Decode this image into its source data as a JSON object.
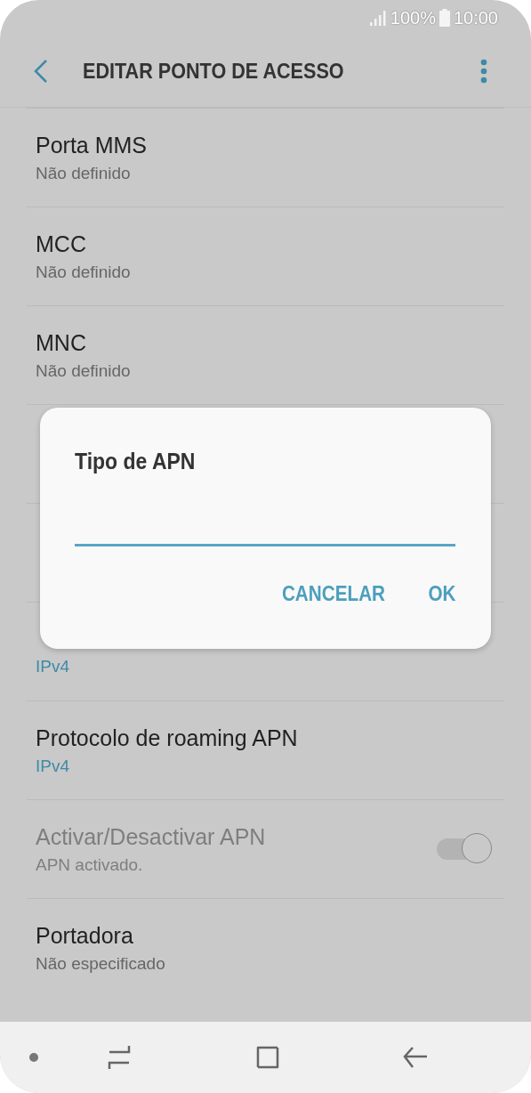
{
  "status_bar": {
    "battery": "100%",
    "time": "10:00"
  },
  "header": {
    "title": "EDITAR PONTO DE ACESSO"
  },
  "settings": [
    {
      "kind": "text",
      "title": "Porta MMS",
      "value": "Não definido",
      "highlighted": false,
      "disabled": false
    },
    {
      "kind": "text",
      "title": "MCC",
      "value": "Não definido",
      "highlighted": false,
      "disabled": false
    },
    {
      "kind": "text",
      "title": "MNC",
      "value": "Não definido",
      "highlighted": false,
      "disabled": false
    },
    {
      "kind": "text"
    },
    {
      "kind": "text"
    },
    {
      "kind": "text",
      "value": "IPv4",
      "highlighted": true,
      "disabled": false
    },
    {
      "kind": "text",
      "title": "Protocolo de roaming APN",
      "value": "IPv4",
      "highlighted": true,
      "disabled": false
    },
    {
      "kind": "switch",
      "title": "Activar/Desactivar APN",
      "value": "APN activado.",
      "highlighted": false,
      "disabled": true,
      "checked": true
    },
    {
      "kind": "text",
      "title": "Portadora",
      "value": "Não especificado",
      "highlighted": false,
      "disabled": false
    }
  ],
  "dialog": {
    "title": "Tipo de APN",
    "buttons": [
      "CANCELAR",
      "OK"
    ]
  }
}
